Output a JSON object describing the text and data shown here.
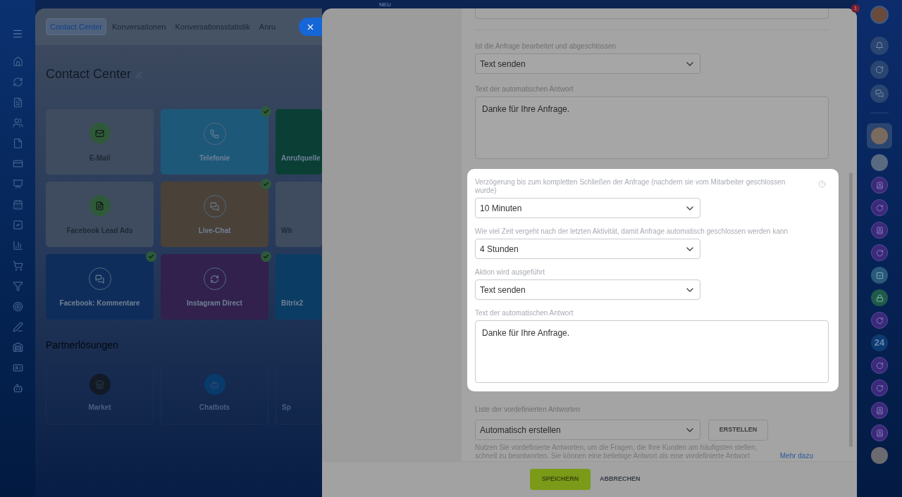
{
  "top_bar": {
    "badge": "NEU",
    "notification_count": "1"
  },
  "background_page": {
    "tabs": [
      {
        "label": "Contact Center",
        "selected": true
      },
      {
        "label": "Konversationen",
        "selected": false
      },
      {
        "label": "Konversationsstatistik",
        "selected": false
      },
      {
        "label": "Anru",
        "selected": false
      }
    ],
    "title": "Contact Center",
    "tiles": [
      {
        "label": "E-Mail",
        "kind": "light",
        "color": "#3f4c5f",
        "connected": false
      },
      {
        "label": "Telefonie",
        "kind": "filled",
        "color": "#1e5878",
        "connected": true
      },
      {
        "label": "Anrufquelle",
        "kind": "filled",
        "color": "#0b3f36",
        "connected": false
      },
      {
        "label": "Facebook Lead Ads",
        "kind": "light",
        "color": "#3f4c5f",
        "connected": false
      },
      {
        "label": "Live-Chat",
        "kind": "filled",
        "color": "#4a4138",
        "connected": true
      },
      {
        "label": "Wh",
        "kind": "light",
        "color": "#3f4c5f",
        "connected": false
      },
      {
        "label": "Facebook: Kommentare",
        "kind": "filled",
        "color": "#0f2d5a",
        "connected": true
      },
      {
        "label": "Instagram Direct",
        "kind": "filled",
        "color": "#32204d",
        "connected": true
      },
      {
        "label": "Bitrix2",
        "kind": "filled",
        "color": "#0b3c63",
        "connected": false
      }
    ],
    "partner_title": "Partnerlösungen",
    "partner_tiles": [
      {
        "label": "Market"
      },
      {
        "label": "Chatbots"
      },
      {
        "label": "Sp"
      }
    ]
  },
  "form": {
    "top": [
      {
        "kind": "select",
        "label": "Ist die Anfrage bearbeitet und abgeschlossen",
        "value": "Text senden"
      },
      {
        "kind": "textarea",
        "label": "Text der automatischen Antwort",
        "value": "Danke für Ihre Anfrage."
      }
    ],
    "highlighted": [
      {
        "kind": "select",
        "label": "Verzögerung bis zum kompletten Schließen der Anfrage (nachdem sie vom Mitarbeiter geschlossen wurde)",
        "value": "10 Minuten",
        "help": true
      },
      {
        "kind": "select",
        "label": "Wie viel Zeit vergeht nach der letzten Aktivität, damit Anfrage automatisch geschlossen werden kann",
        "value": "4 Stunden"
      },
      {
        "kind": "select",
        "label": "Aktion wird ausgeführt",
        "value": "Text senden"
      },
      {
        "kind": "textarea",
        "label": "Text der automatischen Antwort",
        "value": "Danke für Ihre Anfrage."
      }
    ],
    "answers_label": "Liste der vordefinierten Antworten",
    "answers_value": "Automatisch erstellen",
    "create_button": "ERSTELLEN",
    "hint": "Nutzen Sie vordefinierte Antworten, um die Fragen, die Ihre Kunden am häufigsten stellen, schnell zu beantworten. Sie können eine beliebige Antwort als eine vordefinierte Antwort",
    "hint_link": "Mehr dazu"
  },
  "footer": {
    "save": "SPEICHERN",
    "cancel": "ABBRECHEN"
  },
  "right_bar": {
    "counter_label": "24"
  }
}
